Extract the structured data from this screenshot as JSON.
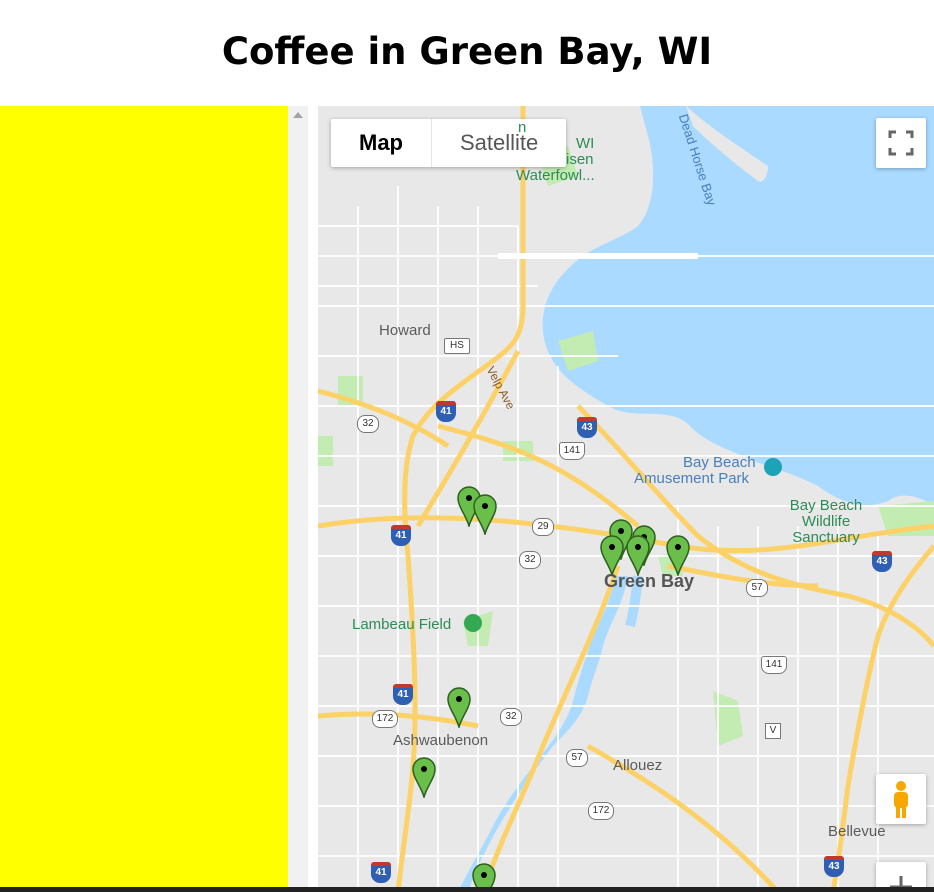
{
  "page": {
    "title": "Coffee in Green Bay, WI"
  },
  "map": {
    "map_type_options": [
      "Map",
      "Satellite"
    ],
    "selected_map_type": "Map",
    "labels": {
      "waterfowl": "Bay Beach Waterfowl...",
      "waterfowl_partial": [
        "n",
        "WI",
        "isen",
        "Waterfowl..."
      ],
      "dead_horse_bay": "Dead Horse Bay",
      "howard": "Howard",
      "velp_ave": "Velp Ave",
      "amusement_park": [
        "Bay Beach",
        "Amusement Park"
      ],
      "sanctuary": [
        "Bay Beach",
        "Wildlife",
        "Sanctuary"
      ],
      "green_bay": "Green Bay",
      "lambeau_field": "Lambeau Field",
      "ashwaubenon": "Ashwaubenon",
      "allouez": "Allouez",
      "bellevue": "Bellevue"
    },
    "shields": {
      "hs": "HS",
      "i41_a": "41",
      "i41_b": "41",
      "i41_c": "41",
      "i41_d": "41",
      "i43_a": "43",
      "i43_b": "43",
      "i43_c": "43",
      "us141_a": "141",
      "us141_b": "141",
      "s32_a": "32",
      "s32_b": "32",
      "s32_c": "32",
      "s29": "29",
      "s57_a": "57",
      "s57_b": "57",
      "s172_a": "172",
      "s172_b": "172",
      "v": "V"
    },
    "marker_count": 10,
    "colors": {
      "water": "#aadaff",
      "land": "#e8e8e8",
      "highway": "#fcd168",
      "park": "#c3ecb2",
      "marker": "#6abf4b"
    },
    "icons": [
      "fullscreen-icon",
      "pegman-icon",
      "zoom-in-icon",
      "map-marker-icon"
    ]
  }
}
